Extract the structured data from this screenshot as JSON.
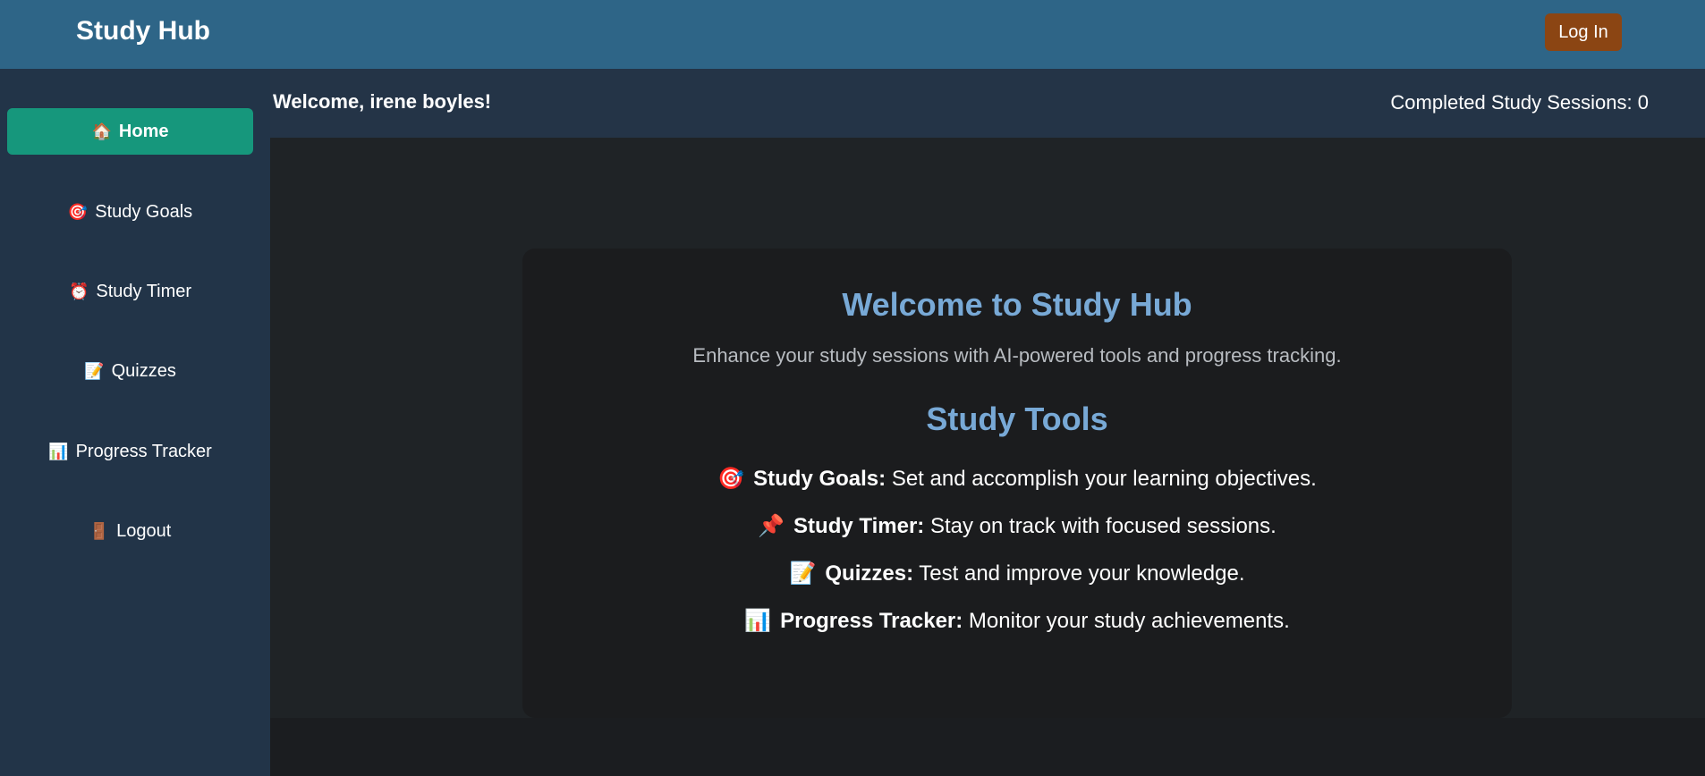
{
  "header": {
    "brand": "Study Hub",
    "login_label": "Log In"
  },
  "sidebar": {
    "items": [
      {
        "icon": "🏠",
        "label": "Home",
        "active": true
      },
      {
        "icon": "🎯",
        "label": "Study Goals"
      },
      {
        "icon": "⏰",
        "label": "Study Timer"
      },
      {
        "icon": "📝",
        "label": "Quizzes"
      },
      {
        "icon": "📊",
        "label": "Progress Tracker"
      },
      {
        "icon": "🚪",
        "label": "Logout"
      }
    ]
  },
  "welcome_bar": {
    "welcome": "Welcome, irene boyles!",
    "sessions": "Completed Study Sessions: 0"
  },
  "main": {
    "title": "Welcome to Study Hub",
    "subtitle": "Enhance your study sessions with AI-powered tools and progress tracking.",
    "tools_title": "Study Tools",
    "tools": [
      {
        "icon": "🎯",
        "name": "Study Goals:",
        "desc": "Set and accomplish your learning objectives."
      },
      {
        "icon": "📌",
        "name": "Study Timer:",
        "desc": "Stay on track with focused sessions."
      },
      {
        "icon": "📝",
        "name": "Quizzes:",
        "desc": "Test and improve your knowledge."
      },
      {
        "icon": "📊",
        "name": "Progress Tracker:",
        "desc": "Monitor your study achievements."
      }
    ]
  },
  "colors": {
    "header_bg": "#2e6587",
    "sidebar_bg": "#223448",
    "active_nav": "#16977c",
    "login_btn": "#8b4513",
    "heading": "#78a9d6"
  }
}
